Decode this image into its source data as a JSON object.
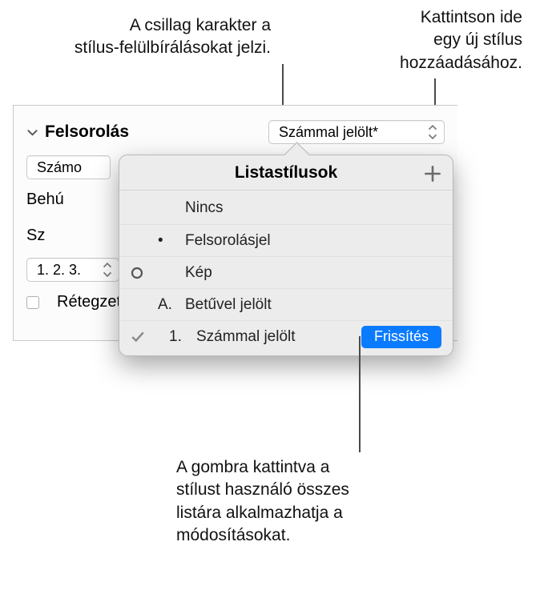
{
  "callouts": {
    "asterisk": "A csillag karakter a\nstílus-felülbírálásokat jelzi.",
    "add": "Kattintson ide\negy új stílus\nhozzáadásához.",
    "update": "A gombra kattintva a\nstílust használó összes\nlistára alkalmazhatja a\nmódosításokat."
  },
  "panel": {
    "section": "Felsorolás",
    "style_selected": "Számmal jelölt*",
    "numbering_truncated": "Számo",
    "indent_truncated": "Behú",
    "width_truncated": "Sz",
    "format_row": "1. 2. 3.",
    "tiered": "Rétegzett számok"
  },
  "popover": {
    "title": "Listastílusok",
    "items": [
      {
        "prefix": "",
        "label": "Nincs"
      },
      {
        "prefix": "•",
        "label": "Felsorolásjel"
      },
      {
        "prefix": "img",
        "label": "Kép"
      },
      {
        "prefix": "A.",
        "label": "Betűvel jelölt"
      },
      {
        "prefix": "1.",
        "label": "Számmal jelölt",
        "selected": true,
        "update_label": "Frissítés"
      }
    ]
  }
}
